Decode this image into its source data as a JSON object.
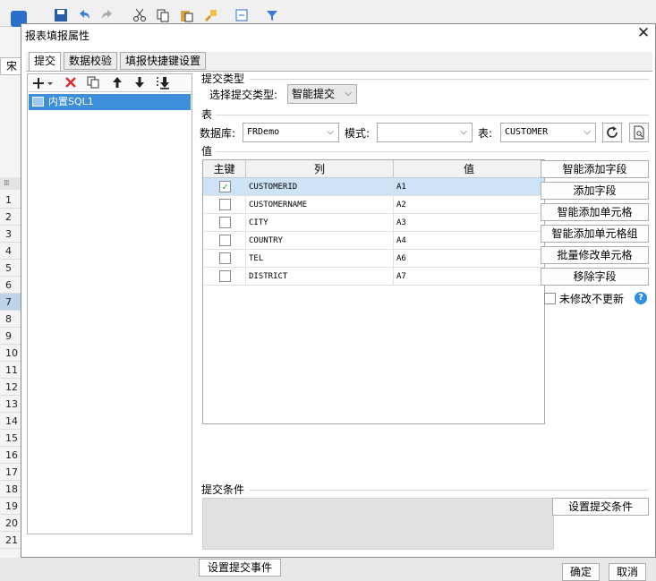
{
  "dialog": {
    "title": "报表填报属性",
    "tabs": [
      "提交",
      "数据校验",
      "填报快捷键设置"
    ]
  },
  "background": {
    "font_label": "宋",
    "row_numbers": [
      "1",
      "2",
      "3",
      "4",
      "5",
      "6",
      "7",
      "8",
      "9",
      "10",
      "11",
      "12",
      "13",
      "14",
      "15",
      "16",
      "17",
      "18",
      "19",
      "20",
      "21"
    ],
    "active_row": "7"
  },
  "tree": {
    "item": "内置SQL1"
  },
  "submit_type": {
    "section": "提交类型",
    "label": "选择提交类型:",
    "value": "智能提交"
  },
  "table_section": {
    "section": "表",
    "db_label": "数据库:",
    "db_value": "FRDemo",
    "schema_label": "模式:",
    "schema_value": "",
    "table_label": "表:",
    "table_value": "CUSTOMER"
  },
  "values_section": {
    "section": "值",
    "headers": {
      "key": "主键",
      "column": "列",
      "value": "值"
    },
    "rows": [
      {
        "column": "CUSTOMERID",
        "value": "A1",
        "checked": true
      },
      {
        "column": "CUSTOMERNAME",
        "value": "A2",
        "checked": false
      },
      {
        "column": "CITY",
        "value": "A3",
        "checked": false
      },
      {
        "column": "COUNTRY",
        "value": "A4",
        "checked": false
      },
      {
        "column": "TEL",
        "value": "A6",
        "checked": false
      },
      {
        "column": "DISTRICT",
        "value": "A7",
        "checked": false
      }
    ]
  },
  "side_buttons": {
    "smart_add_field": "智能添加字段",
    "add_field": "添加字段",
    "smart_add_cell": "智能添加单元格",
    "smart_add_cell_group": "智能添加单元格组",
    "batch_modify_cell": "批量修改单元格",
    "remove_field": "移除字段",
    "no_update_label": "未修改不更新"
  },
  "condition": {
    "section": "提交条件",
    "set_button": "设置提交条件"
  },
  "event_button": "设置提交事件",
  "footer": {
    "ok": "确定",
    "cancel": "取消"
  },
  "colors": {
    "selection": "#3d8fd9",
    "check": "#1a9e2e",
    "delete": "#e02a2a",
    "help": "#2f8fe0"
  }
}
